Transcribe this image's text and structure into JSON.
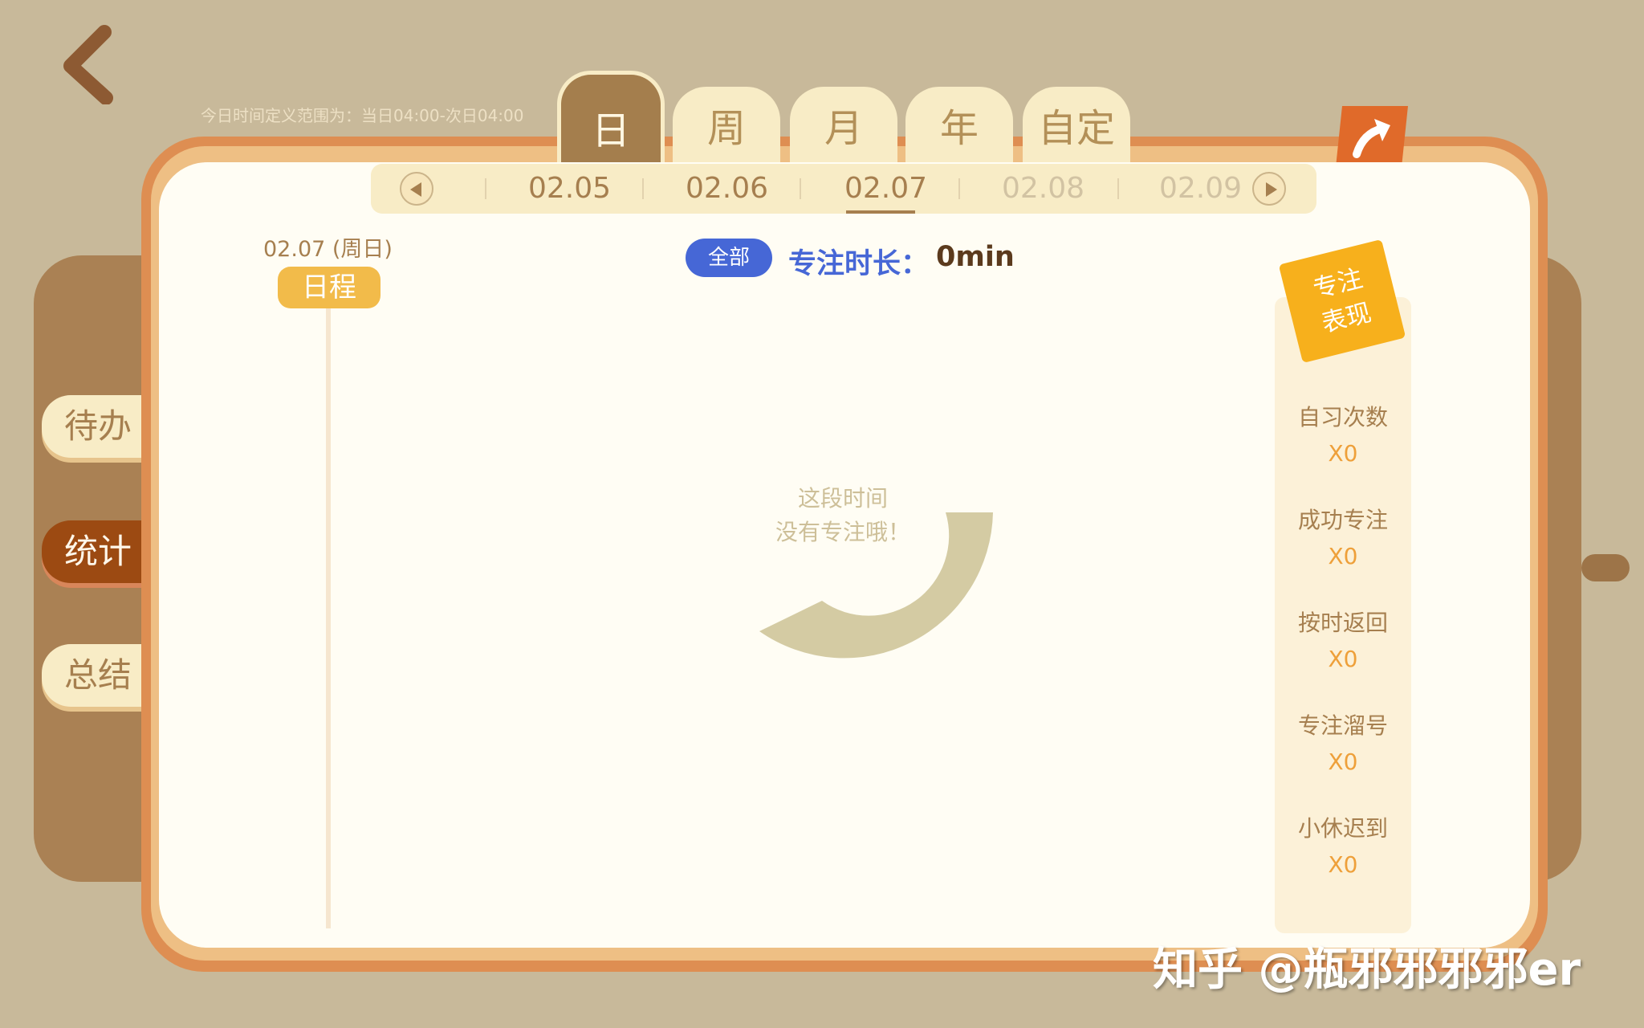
{
  "header": {
    "range_note": "今日时间定义范围为：当日04:00-次日04:00",
    "tabs": [
      {
        "label": "日",
        "active": true
      },
      {
        "label": "周"
      },
      {
        "label": "月"
      },
      {
        "label": "年"
      },
      {
        "label": "自定"
      }
    ]
  },
  "sidebar": {
    "tabs": [
      {
        "label": "待办"
      },
      {
        "label": "统计",
        "active": true
      },
      {
        "label": "总结"
      }
    ]
  },
  "date_strip": {
    "dates": [
      "02.05",
      "02.06",
      "02.07",
      "02.08",
      "02.09"
    ],
    "selected": "02.07"
  },
  "main": {
    "day_label": "02.07 (周日)",
    "schedule_label": "日程",
    "filter_label": "全部",
    "focus_label": "专注时长：",
    "focus_value": "0min",
    "empty_line1": "这段时间",
    "empty_line2": "没有专注哦！"
  },
  "panel": {
    "badge_line1": "专注",
    "badge_line2": "表现",
    "stats": [
      {
        "label": "自习次数",
        "value": "X0"
      },
      {
        "label": "成功专注",
        "value": "X0"
      },
      {
        "label": "按时返回",
        "value": "X0"
      },
      {
        "label": "专注溜号",
        "value": "X0"
      },
      {
        "label": "小休迟到",
        "value": "X0"
      }
    ]
  },
  "watermark": "知乎 @瓶邪邪邪邪er",
  "colors": {
    "background": "#c8b99a",
    "accent_blue": "#4667d6",
    "accent_orange": "#f7b01c",
    "active_tab": "#a47e4d"
  }
}
